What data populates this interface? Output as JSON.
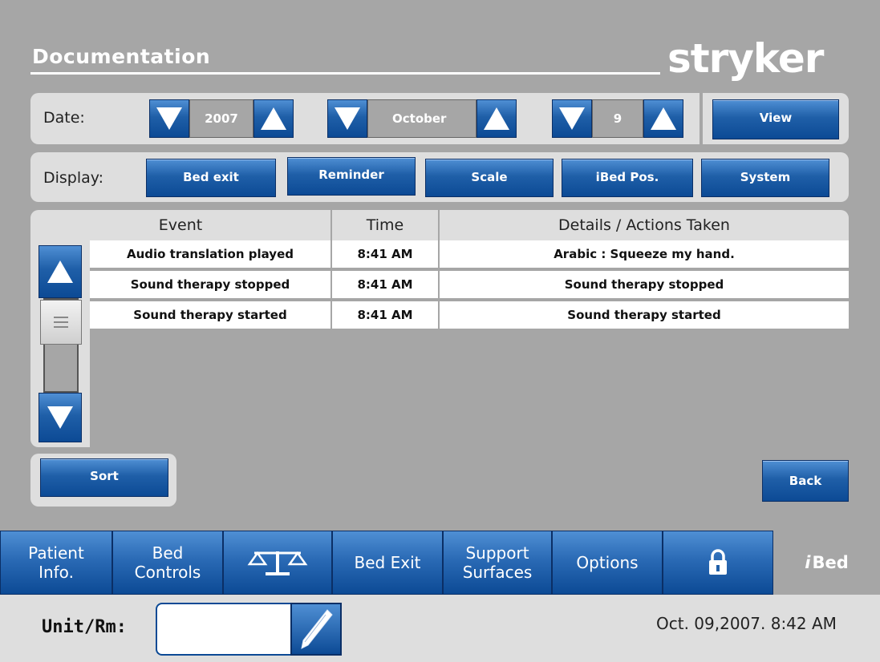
{
  "header": {
    "title": "Documentation",
    "brand": "stryker"
  },
  "date_filter": {
    "label": "Date:",
    "year": "2007",
    "month": "October",
    "day": "9",
    "view_label": "View"
  },
  "display_filter": {
    "label": "Display:",
    "buttons": [
      "Bed exit",
      "Reminder",
      "Scale",
      "iBed Pos.",
      "System"
    ]
  },
  "table": {
    "columns": [
      "Event",
      "Time",
      "Details / Actions Taken"
    ],
    "rows": [
      {
        "event": "Audio translation played",
        "time": "8:41 AM",
        "details": "Arabic : Squeeze my hand."
      },
      {
        "event": "Sound therapy stopped",
        "time": "8:41 AM",
        "details": "Sound therapy stopped"
      },
      {
        "event": "Sound therapy started",
        "time": "8:41 AM",
        "details": "Sound therapy started"
      }
    ]
  },
  "actions": {
    "sort_label": "Sort",
    "back_label": "Back"
  },
  "nav": {
    "patient_info": [
      "Patient",
      "Info."
    ],
    "bed_controls": [
      "Bed",
      "Controls"
    ],
    "scale_icon": "scale-icon",
    "bed_exit": "Bed Exit",
    "support_surfaces": [
      "Support",
      "Surfaces"
    ],
    "options": "Options",
    "lock_icon": "lock-icon",
    "ibed": "Bed"
  },
  "status_bar": {
    "unit_label": "Unit/Rm:",
    "unit_value": "",
    "datetime": "Oct. 09,2007. 8:42 AM"
  },
  "colors": {
    "accent": "#1f5fa8",
    "background": "#a6a6a6",
    "panel": "#dedede"
  }
}
